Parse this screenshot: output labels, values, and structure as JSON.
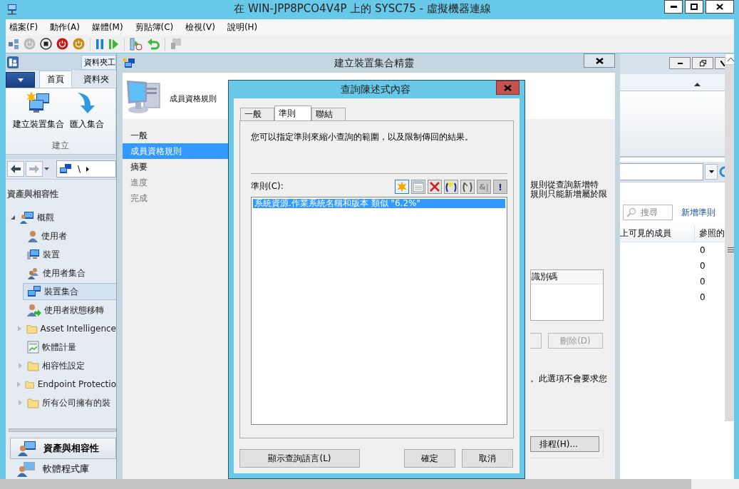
{
  "window": {
    "title": "在 WIN-JPP8PCO4V4P 上的 SYSC75 - 虛擬機器連線"
  },
  "menu": [
    "檔案(F)",
    "動作(A)",
    "媒體(M)",
    "剪貼簿(C)",
    "檢視(V)",
    "說明(H)"
  ],
  "console": {
    "title_tab": "資料夾工",
    "ribbon_tabs": [
      {
        "label": "首頁",
        "selected": true
      },
      {
        "label": "資料夾",
        "selected": false
      }
    ],
    "ribbon_buttons": [
      {
        "label": "建立裝置集合",
        "kind": "create"
      },
      {
        "label": "匯入集合",
        "kind": "import"
      }
    ],
    "ribbon_group": "建立",
    "address_path": "\\",
    "nav_title": "資產與相容性",
    "tree": [
      {
        "label": "概觀",
        "kind": "overview",
        "expanded": true,
        "selected": false,
        "children": [
          {
            "label": "使用者",
            "kind": "user",
            "selected": false
          },
          {
            "label": "裝置",
            "kind": "device",
            "selected": false
          },
          {
            "label": "使用者集合",
            "kind": "user_collection",
            "selected": false
          },
          {
            "label": "裝置集合",
            "kind": "device_collection",
            "selected": true
          },
          {
            "label": "使用者狀態移轉",
            "kind": "migration",
            "selected": false
          },
          {
            "label": "Asset Intelligence",
            "kind": "folder",
            "expanded": false,
            "selected": false
          },
          {
            "label": "軟體計量",
            "kind": "metering",
            "selected": false
          },
          {
            "label": "相容性設定",
            "kind": "folder",
            "expanded": false,
            "selected": false
          },
          {
            "label": "Endpoint Protectio",
            "kind": "folder",
            "expanded": false,
            "selected": false
          },
          {
            "label": "所有公司擁有的裝",
            "kind": "folder",
            "expanded": false,
            "selected": false
          }
        ]
      }
    ],
    "workspaces": [
      {
        "label": "資產與相容性",
        "selected": true
      },
      {
        "label": "軟體程式庫",
        "selected": false
      }
    ],
    "search_placeholder": "搜尋",
    "add_criteria": "新增準則",
    "columns": [
      "上可見的成員",
      "參照的"
    ],
    "column_2_values": [
      "0",
      "0",
      "0",
      "0"
    ]
  },
  "wizard": {
    "title": "建立裝置集合精靈",
    "page_title": "成員資格規則",
    "steps": [
      {
        "label": "一般",
        "selected": false,
        "disabled": false
      },
      {
        "label": "成員資格規則",
        "selected": true,
        "disabled": false
      },
      {
        "label": "摘要",
        "selected": false,
        "disabled": false
      },
      {
        "label": "進度",
        "selected": false,
        "disabled": true
      },
      {
        "label": "完成",
        "selected": false,
        "disabled": true
      }
    ],
    "text_lines": [
      "規則從查詢新增特",
      "規則只能新增屬於限"
    ],
    "list_header": "識別碼",
    "delete_button": {
      "label": "刪除(D)",
      "disabled": true
    },
    "note": "。此選項不會要求您",
    "schedule_button": "排程(H)..."
  },
  "dialog": {
    "title": "查詢陳述式內容",
    "tabs": [
      {
        "label": "一般",
        "selected": false
      },
      {
        "label": "準則",
        "selected": true
      },
      {
        "label": "聯結",
        "selected": false
      }
    ],
    "description": "您可以指定準則來縮小查詢的範圍，以及限制傳回的結果。",
    "criteria_label": "準則(C):",
    "tool_buttons": [
      {
        "kind": "new"
      },
      {
        "kind": "properties"
      },
      {
        "kind": "delete"
      },
      {
        "kind": "add_group"
      },
      {
        "kind": "ungroup"
      },
      {
        "kind": "text",
        "label": "&|"
      },
      {
        "kind": "text",
        "label": "!"
      }
    ],
    "criteria": [
      {
        "text": "系統資源.作業系統名稱和版本 類似 \"6.2%\"",
        "selected": true
      }
    ],
    "buttons": [
      "顯示查詢語言(L)",
      "確定",
      "取消"
    ]
  }
}
